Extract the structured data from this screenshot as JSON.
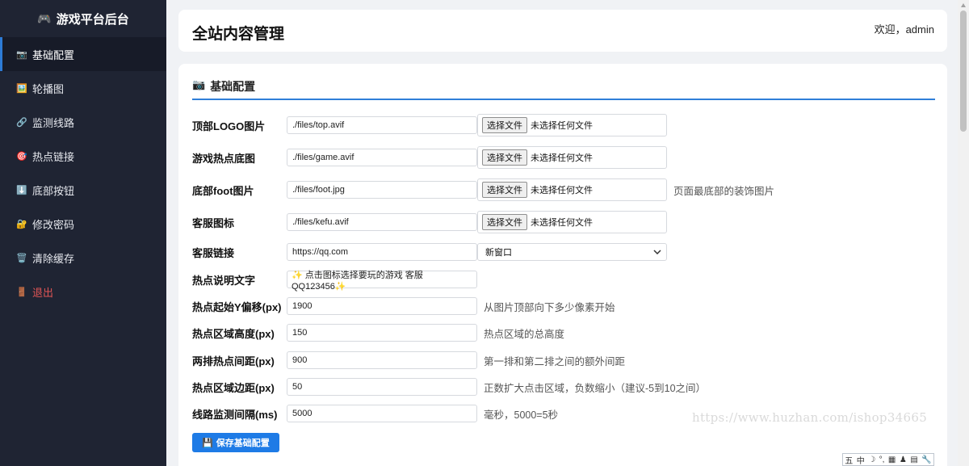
{
  "sidebar": {
    "brand_icon": "🎮",
    "brand": "游戏平台后台",
    "items": [
      {
        "icon": "📷",
        "label": "基础配置",
        "icon_name": "camera-icon"
      },
      {
        "icon": "🖼️",
        "label": "轮播图",
        "icon_name": "picture-icon"
      },
      {
        "icon": "🔗",
        "label": "监测线路",
        "icon_name": "link-icon"
      },
      {
        "icon": "🎯",
        "label": "热点链接",
        "icon_name": "target-icon"
      },
      {
        "icon": "⬇️",
        "label": "底部按钮",
        "icon_name": "down-arrow-icon"
      },
      {
        "icon": "🔐",
        "label": "修改密码",
        "icon_name": "lock-icon"
      },
      {
        "icon": "🗑️",
        "label": "清除缓存",
        "icon_name": "trash-icon"
      },
      {
        "icon": "🚪",
        "label": "退出",
        "icon_name": "door-icon"
      }
    ]
  },
  "header": {
    "title": "全站内容管理",
    "welcome": "欢迎，admin"
  },
  "section": {
    "icon": "📷",
    "title": "基础配置"
  },
  "file_button_label": "选择文件",
  "no_file_label": "未选择任何文件",
  "form": {
    "top_logo": {
      "label": "顶部LOGO图片",
      "value": "./files/top.avif"
    },
    "game_bg": {
      "label": "游戏热点底图",
      "value": "./files/game.avif"
    },
    "foot_img": {
      "label": "底部foot图片",
      "value": "./files/foot.jpg",
      "hint": "页面最底部的装饰图片"
    },
    "kefu_icon": {
      "label": "客服图标",
      "value": "./files/kefu.avif"
    },
    "kefu_link": {
      "label": "客服链接",
      "value": "https://qq.com",
      "target": "新窗口"
    },
    "hotspot_text": {
      "label": "热点说明文字",
      "value": "✨ 点击图标选择要玩的游戏 客服QQ123456✨"
    },
    "hotspot_y": {
      "label": "热点起始Y偏移(px)",
      "value": "1900",
      "hint": "从图片顶部向下多少像素开始"
    },
    "hotspot_h": {
      "label": "热点区域高度(px)",
      "value": "150",
      "hint": "热点区域的总高度"
    },
    "row_gap": {
      "label": "两排热点间距(px)",
      "value": "900",
      "hint": "第一排和第二排之间的额外间距"
    },
    "hotspot_margin": {
      "label": "热点区域边距(px)",
      "value": "50",
      "hint": "正数扩大点击区域，负数缩小（建议-5到10之间）"
    },
    "monitor_interval": {
      "label": "线路监测间隔(ms)",
      "value": "5000",
      "hint": "毫秒，5000=5秒"
    }
  },
  "save_button": {
    "icon": "💾",
    "label": "保存基础配置",
    "color": "#1e7be6"
  },
  "watermark": "https://www.huzhan.com/ishop34665",
  "ime_bar": [
    "五",
    "中",
    "☽",
    "°,",
    "▦",
    "♟",
    "▤",
    "🔧"
  ],
  "colors": {
    "sidebar_bg": "#1f2433",
    "accent": "#2f7fd8",
    "logout": "#e05555"
  }
}
